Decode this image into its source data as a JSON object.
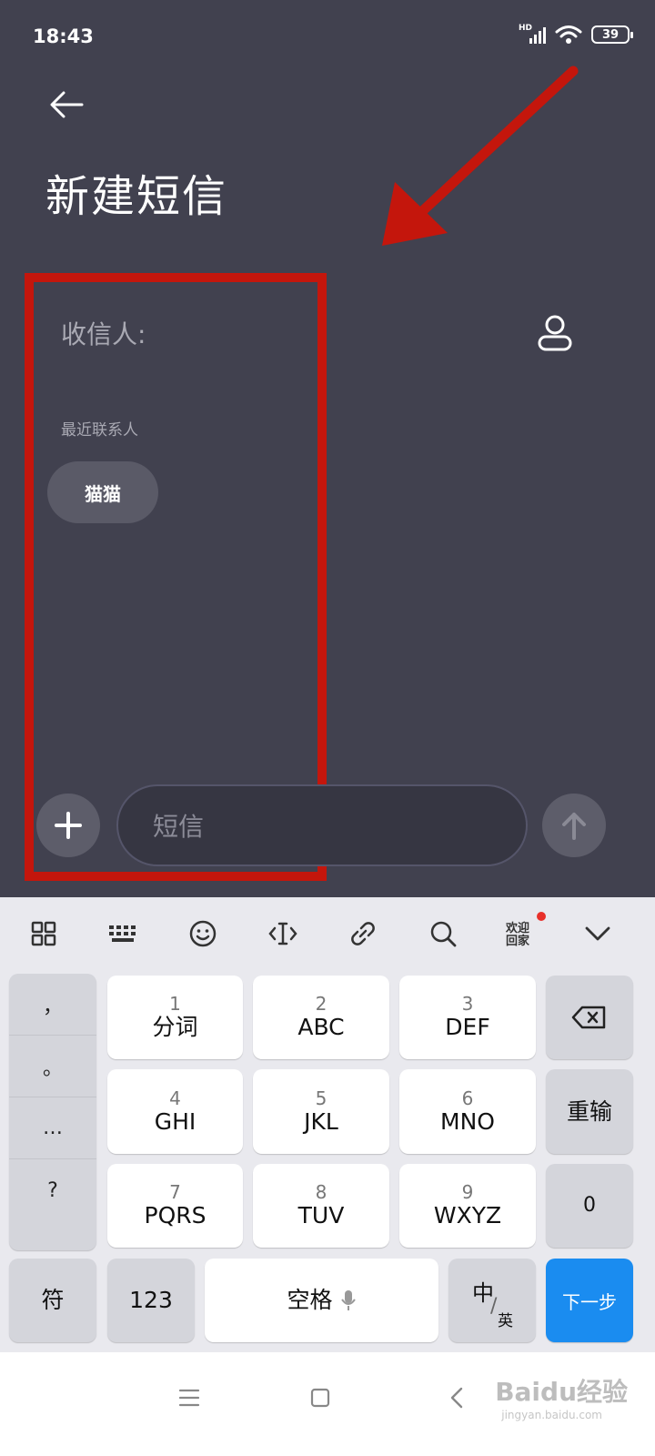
{
  "status_bar": {
    "time": "18:43",
    "battery": "39",
    "network": "HD"
  },
  "header": {
    "title": "新建短信"
  },
  "recipient": {
    "label": "收信人:"
  },
  "recent": {
    "label": "最近联系人",
    "contacts": [
      "猫猫"
    ]
  },
  "composer": {
    "placeholder": "短信"
  },
  "keyboard": {
    "toolbar_welcome_line1": "欢迎",
    "toolbar_welcome_line2": "回家",
    "punctuation": [
      "，",
      "。",
      "…",
      "?"
    ],
    "keys": [
      {
        "num": "1",
        "label": "分词"
      },
      {
        "num": "2",
        "label": "ABC"
      },
      {
        "num": "3",
        "label": "DEF"
      },
      {
        "num": "4",
        "label": "GHI"
      },
      {
        "num": "5",
        "label": "JKL"
      },
      {
        "num": "6",
        "label": "MNO"
      },
      {
        "num": "7",
        "label": "PQRS"
      },
      {
        "num": "8",
        "label": "TUV"
      },
      {
        "num": "9",
        "label": "WXYZ"
      }
    ],
    "reenter": "重输",
    "zero": "0",
    "symbols": "符",
    "numbers": "123",
    "space": "空格",
    "lang_top": "中",
    "lang_bottom": "英",
    "next": "下一步"
  },
  "watermark": {
    "text": "Baidu经验",
    "sub": "jingyan.baidu.com"
  },
  "colors": {
    "background": "#41414f",
    "highlight": "#c4160c",
    "accent": "#1a8cf0"
  }
}
